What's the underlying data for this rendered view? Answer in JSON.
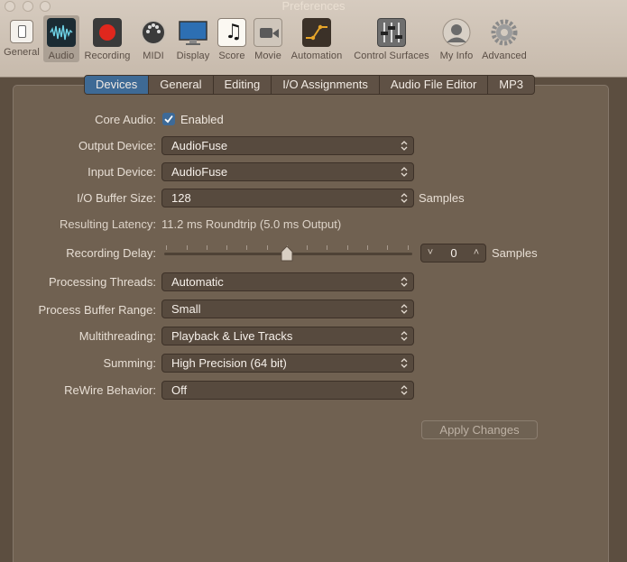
{
  "window": {
    "title": "Preferences"
  },
  "toolbar": {
    "items": [
      {
        "label": "General",
        "icon": "general-icon"
      },
      {
        "label": "Audio",
        "icon": "audio-waveform-icon",
        "selected": true
      },
      {
        "label": "Recording",
        "icon": "record-icon"
      },
      {
        "label": "MIDI",
        "icon": "midi-icon"
      },
      {
        "label": "Display",
        "icon": "display-icon"
      },
      {
        "label": "Score",
        "icon": "score-icon"
      },
      {
        "label": "Movie",
        "icon": "movie-icon"
      },
      {
        "label": "Automation",
        "icon": "automation-icon"
      },
      {
        "label": "Control Surfaces",
        "icon": "control-surfaces-icon"
      },
      {
        "label": "My Info",
        "icon": "user-icon"
      },
      {
        "label": "Advanced",
        "icon": "gear-icon"
      }
    ]
  },
  "tabs": [
    {
      "label": "Devices",
      "active": true
    },
    {
      "label": "General"
    },
    {
      "label": "Editing"
    },
    {
      "label": "I/O Assignments"
    },
    {
      "label": "Audio File Editor"
    },
    {
      "label": "MP3"
    }
  ],
  "form": {
    "core_audio": {
      "label": "Core Audio:",
      "checkbox_label": "Enabled",
      "checked": true
    },
    "output_device": {
      "label": "Output Device:",
      "value": "AudioFuse"
    },
    "input_device": {
      "label": "Input Device:",
      "value": "AudioFuse"
    },
    "io_buffer_size": {
      "label": "I/O Buffer Size:",
      "value": "128",
      "unit": "Samples"
    },
    "resulting_latency": {
      "label": "Resulting Latency:",
      "value": "11.2 ms Roundtrip (5.0 ms Output)"
    },
    "recording_delay": {
      "label": "Recording Delay:",
      "value": "0",
      "unit": "Samples",
      "slider_position": 0.5
    },
    "processing_threads": {
      "label": "Processing Threads:",
      "value": "Automatic"
    },
    "process_buffer_range": {
      "label": "Process Buffer Range:",
      "value": "Small"
    },
    "multithreading": {
      "label": "Multithreading:",
      "value": "Playback & Live Tracks"
    },
    "summing": {
      "label": "Summing:",
      "value": "High Precision (64 bit)"
    },
    "rewire_behavior": {
      "label": "ReWire Behavior:",
      "value": "Off"
    }
  },
  "apply_button": {
    "label": "Apply Changes",
    "enabled": false
  },
  "colors": {
    "accent": "#3e6a95",
    "panel": "#706151",
    "window_bg": "#5c4e40"
  }
}
